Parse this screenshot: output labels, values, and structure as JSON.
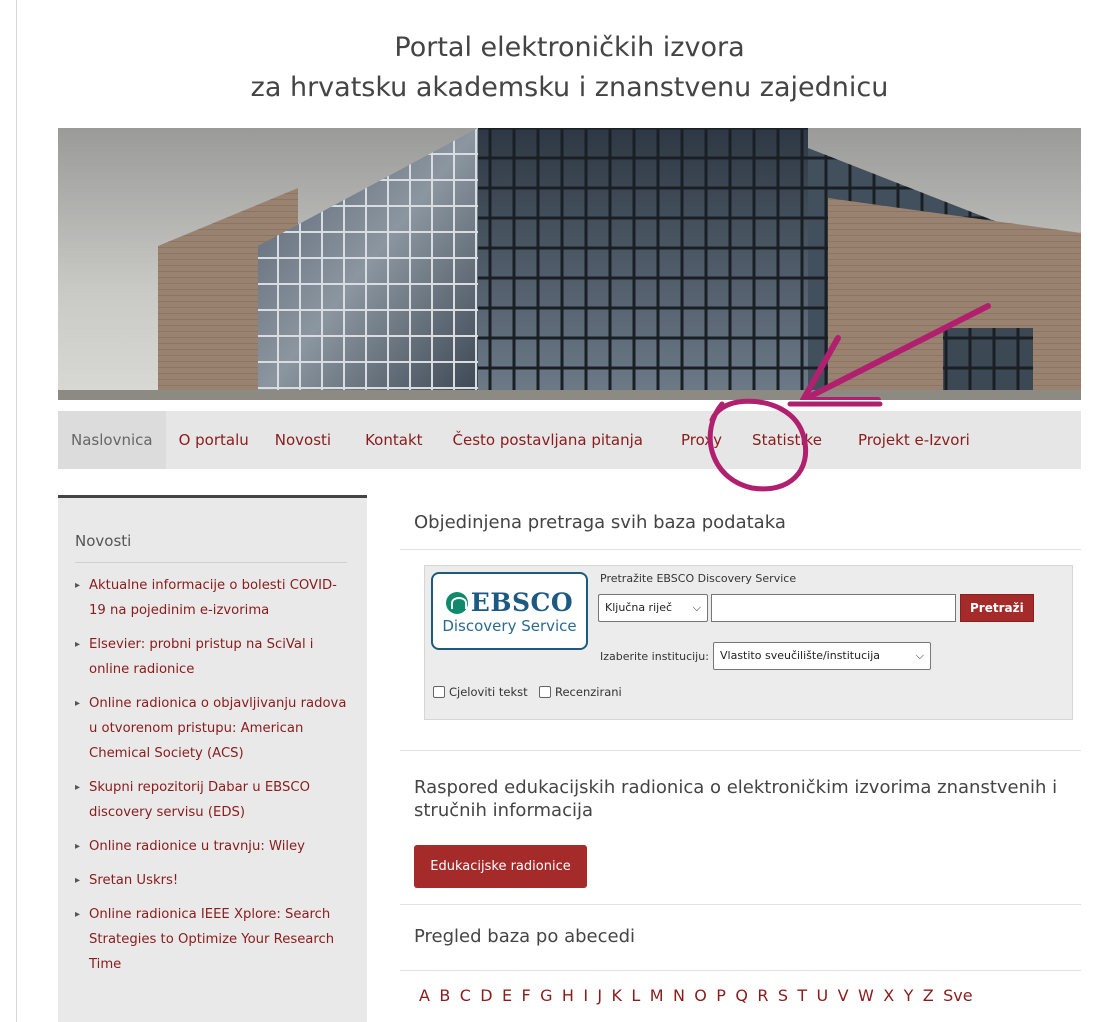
{
  "site": {
    "title_line1": "Portal elektroničkih izvora",
    "title_line2": "za hrvatsku akademsku i znanstvenu zajednicu"
  },
  "nav": {
    "items": [
      {
        "label": "Naslovnica",
        "active": true
      },
      {
        "label": "O portalu",
        "active": false
      },
      {
        "label": "Novosti",
        "active": false
      },
      {
        "label": "Kontakt",
        "active": false
      },
      {
        "label": "Često postavljana pitanja",
        "active": false
      },
      {
        "label": "Proxy",
        "active": false
      },
      {
        "label": "Statistike",
        "active": false
      },
      {
        "label": "Projekt e-Izvori",
        "active": false
      }
    ]
  },
  "sidebar": {
    "heading": "Novosti",
    "items": [
      "Aktualne informacije o bolesti COVID-19 na pojedinim e-izvorima",
      "Elsevier: probni pristup na SciVal i online radionice",
      "Online radionica o objavljivanju radova u otvorenom pristupu: American Chemical Society (ACS)",
      "Skupni repozitorij Dabar u EBSCO discovery servisu (EDS)",
      "Online radionice u travnju: Wiley",
      "Sretan Uskrs!",
      "Online radionica IEEE Xplore: Search Strategies to Optimize Your Research Time"
    ]
  },
  "search_section": {
    "title": "Objedinjena pretraga svih baza podataka",
    "logo_brand": "EBSCO",
    "logo_sub": "Discovery Service",
    "search_label": "Pretražite EBSCO Discovery Service",
    "field_select": "Ključna riječ",
    "query_value": "",
    "search_button": "Pretraži",
    "institution_label": "Izaberite instituciju:",
    "institution_select": "Vlastito sveučilište/institucija",
    "fulltext_label": "Cjeloviti tekst",
    "peer_reviewed_label": "Recenzirani"
  },
  "workshops_section": {
    "title": "Raspored edukacijskih radionica o elektroničkim izvorima znanstvenih i stručnih informacija",
    "button": "Edukacijske radionice"
  },
  "alpha_section": {
    "title": "Pregled baza po abecedi",
    "letters": [
      "A",
      "B",
      "C",
      "D",
      "E",
      "F",
      "G",
      "H",
      "I",
      "J",
      "K",
      "L",
      "M",
      "N",
      "O",
      "P",
      "Q",
      "R",
      "S",
      "T",
      "U",
      "V",
      "W",
      "X",
      "Y",
      "Z",
      "Sve"
    ]
  },
  "colors": {
    "accent": "#8a1c1c",
    "button": "#a52a2a",
    "annotation": "#b0206e"
  }
}
